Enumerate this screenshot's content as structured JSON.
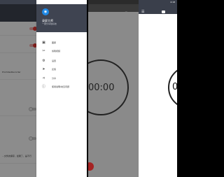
{
  "settings": {
    "rows": [
      {
        "label": ""
      },
      {
        "label": ""
      },
      {
        "label": ""
      },
      {
        "label": "ProVideoRecorder"
      },
      {
        "label": ""
      },
      {
        "label": ""
      },
      {
        "label": ""
      },
      {
        "label": "...文件的保存，如果了，是不行"
      }
    ]
  },
  "drawer": {
    "title": "录屏大师",
    "subtitle": "一键分享给好友",
    "items": [
      {
        "icon": "gallery-icon",
        "label": "图库"
      },
      {
        "icon": "edit-icon",
        "label": "剪辑视频"
      },
      {
        "icon": "settings-icon",
        "label": "设置"
      },
      {
        "icon": "send-icon",
        "label": "反馈"
      },
      {
        "icon": "share-icon",
        "label": "分享"
      },
      {
        "icon": "info-icon",
        "label": "使用说明/常见问题"
      }
    ]
  },
  "timer": {
    "display": "00:00"
  },
  "timer_right": {
    "display": "0("
  },
  "status": {
    "time": "4:18"
  }
}
